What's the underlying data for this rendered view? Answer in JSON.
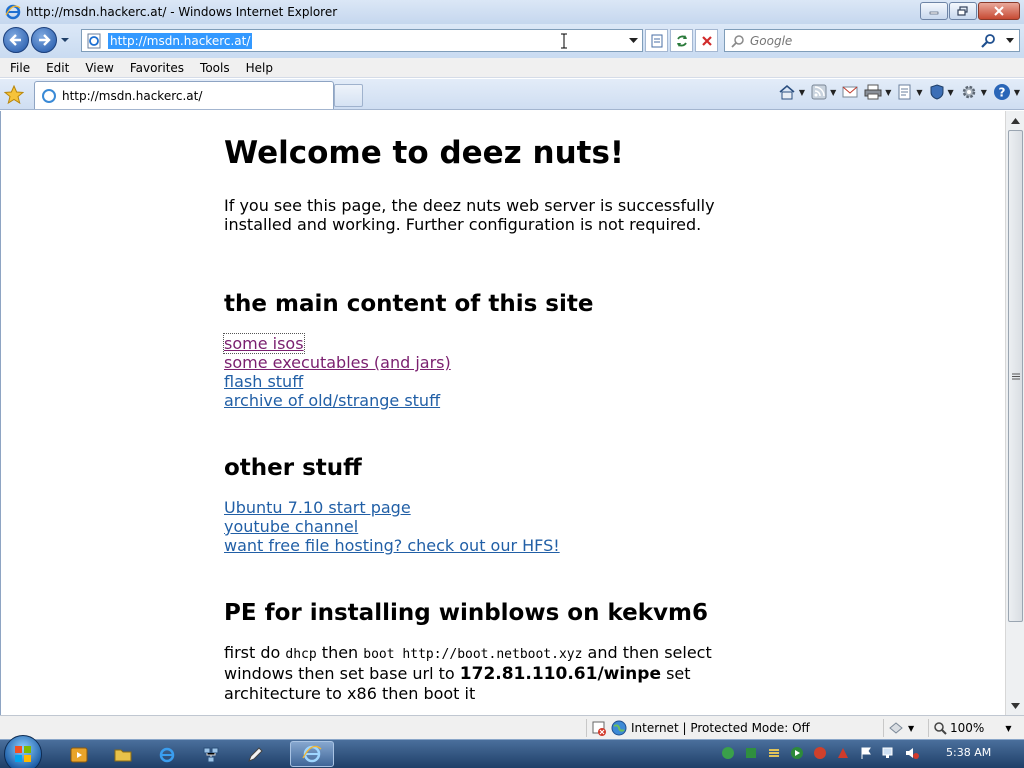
{
  "window": {
    "title": "http://msdn.hackerc.at/ - Windows Internet Explorer"
  },
  "address": {
    "url": "http://msdn.hackerc.at/"
  },
  "search": {
    "placeholder": "Google"
  },
  "menu": [
    "File",
    "Edit",
    "View",
    "Favorites",
    "Tools",
    "Help"
  ],
  "tab": {
    "label": "http://msdn.hackerc.at/"
  },
  "page": {
    "heading": "Welcome to deez nuts!",
    "intro": "If you see this page, the deez nuts web server is successfully installed and working. Further configuration is not required.",
    "main_heading": "the main content of this site",
    "main_links": [
      "some isos",
      "some executables (and jars)",
      "flash stuff",
      "archive of old/strange stuff"
    ],
    "other_heading": "other stuff",
    "other_links": [
      "Ubuntu 7.10 start page",
      "youtube channel",
      "want free file hosting? check out our HFS!"
    ],
    "pe_heading": "PE for installing winblows on kekvm6",
    "pe_text": {
      "t1": "first do ",
      "c1": "dhcp",
      "t2": " then ",
      "c2": "boot http://boot.netboot.xyz",
      "t3": " and then select windows then set base url to ",
      "ip": "172.81.110.61/winpe",
      "t4": " set architecture to x86 then boot it"
    }
  },
  "status": {
    "zone": "Internet | Protected Mode: Off",
    "zoom": "100%"
  },
  "taskbar": {
    "time": "5:38 AM"
  },
  "colors": {
    "link": "#215fa6",
    "visited": "#7a1f6f",
    "taskbar": "#1f3f68"
  }
}
